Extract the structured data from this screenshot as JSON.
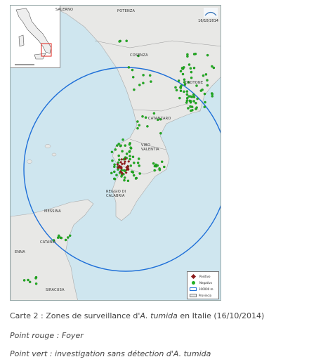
{
  "map": {
    "date": "16/10/2014",
    "logo_text": "IZS",
    "city_labels": [
      "SALERNO",
      "POTENZA",
      "COSENZA",
      "CROTONE",
      "CATANZARO",
      "VIBO VALENTIA",
      "REGGIO DI CALABRIA",
      "MESSINA",
      "CATANIA",
      "ENNA",
      "SIRACUSA"
    ],
    "legend": {
      "positive_label": "Positivo",
      "negative_label": "Negativo",
      "zone_label": "100000 m.",
      "province_label": "Provincia"
    },
    "colors": {
      "sea": "#cfe6ef",
      "land": "#e8e8e6",
      "positive": "#8b1a1a",
      "negative": "#22b022",
      "zone_circle": "#1e6fd8",
      "inset_frame": "#e0201a"
    }
  },
  "captions": {
    "line1_prefix": "Carte 2 : Zones de surveillance d'",
    "line1_species": "A. tumida",
    "line1_suffix": " en Italie (16/10/2014)",
    "line2": "Point rouge : Foyer",
    "line3_prefix": "Point vert : investigation sans détection d'",
    "line3_species": "A. tumida"
  }
}
